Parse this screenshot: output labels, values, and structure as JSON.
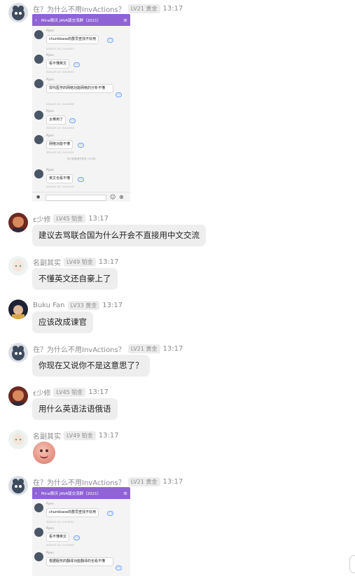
{
  "messages": [
    {
      "name": "在？为什么不用InvActions？",
      "badge": "LV21 黄金",
      "time": "13:17",
      "screenshot": {
        "title": "Mirai聊天 JAVA版交流群（2021）",
        "rows": [
          {
            "user": "Pipen",
            "text": "chunkbase的群员查找不好用",
            "ts": "2024-07-15 / 14:09:51"
          },
          {
            "user": "Pipen",
            "text": "看不懂英文",
            "ts": "2024-07-15 / 14:09:53"
          },
          {
            "user": "Pipen",
            "text": "现代医学的网络功能网络的分析不懂",
            "ts": "2024-07-15 / 14:09:58"
          },
          {
            "user": "Pipen",
            "text": "太难用了",
            "ts": "2024-07-15 / 14:10:04"
          },
          {
            "user": "Pipen",
            "text": "网络功能不懂",
            "ts": "2024-07-15 / 14:10:11"
          },
          {
            "user": "Pipen",
            "text": "英文也看不懂",
            "ts": "2024-07-15 / 14:10:19"
          }
        ],
        "notice": "你已被管理员禁言 15分钟"
      }
    },
    {
      "name": "ε少修",
      "badge": "LV45 铂金",
      "time": "13:17",
      "text": "建议去骂联合国为什么开会不直接用中文交流"
    },
    {
      "name": "名副其实",
      "badge": "LV49 铂金",
      "time": "13:17",
      "text": "不懂英文还自豪上了"
    },
    {
      "name": "Buku Fan",
      "badge": "LV33 黄金",
      "time": "13:17",
      "text": "应该改成谏官"
    },
    {
      "name": "在？为什么不用InvActions？",
      "badge": "LV21 黄金",
      "time": "13:17",
      "text": "你现在又说你不是这意思了？"
    },
    {
      "name": "ε少修",
      "badge": "LV45 铂金",
      "time": "13:17",
      "text": "用什么英语法语俄语"
    },
    {
      "name": "名副其实",
      "badge": "LV49 铂金",
      "time": "13:17",
      "sticker": "smiling-face-sticker"
    },
    {
      "name": "在？为什么不用InvActions？",
      "badge": "LV21 黄金",
      "time": "13:17",
      "screenshot": {
        "title": "Mirai聊天 JAVA版交流群（2021）",
        "rows": [
          {
            "user": "Pipen",
            "text": "chunkbase的群员查找不好用",
            "ts": "2024-07-15 / 14:09:51"
          },
          {
            "user": "Pipen",
            "text": "看不懂英文",
            "ts": "2024-07-15 / 14:09:53"
          },
          {
            "user": "Pipen",
            "text": "根据服务的翻译功能翻译的也看不懂",
            "ts": ""
          }
        ]
      }
    }
  ],
  "colors": {
    "bubble": "#eeeeee",
    "meta": "#8a8a8a",
    "badge_bg": "#ececec",
    "qq_bar": "#8f63d6"
  }
}
